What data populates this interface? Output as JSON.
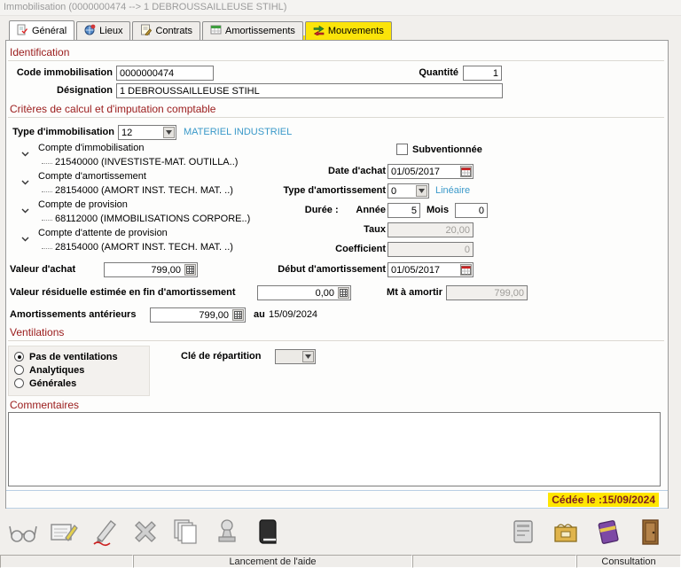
{
  "window": {
    "title": "Immobilisation (0000000474 --> 1 DEBROUSSAILLEUSE STIHL)"
  },
  "tabs": [
    {
      "label": "Général",
      "active": true
    },
    {
      "label": "Lieux",
      "active": false
    },
    {
      "label": "Contrats",
      "active": false
    },
    {
      "label": "Amortissements",
      "active": false
    },
    {
      "label": "Mouvements",
      "active": false,
      "highlighted": true
    }
  ],
  "identification": {
    "section_title": "Identification",
    "code_label": "Code immobilisation",
    "code_value": "0000000474",
    "quantite_label": "Quantité",
    "quantite_value": "1",
    "designation_label": "Désignation",
    "designation_value": "1 DEBROUSSAILLEUSE STIHL"
  },
  "criteres": {
    "section_title": "Critères de calcul et d'imputation comptable",
    "type_immobilisation_label": "Type d'immobilisation",
    "type_immobilisation_value": "12",
    "type_immobilisation_name": "MATERIEL INDUSTRIEL",
    "comptes": [
      {
        "label": "Compte d'immobilisation",
        "value": "21540000 (INVESTISTE-MAT. OUTILLA..)"
      },
      {
        "label": "Compte d'amortissement",
        "value": "28154000 (AMORT INST. TECH. MAT. ..)"
      },
      {
        "label": "Compte de provision",
        "value": "68112000 (IMMOBILISATIONS CORPORE..)"
      },
      {
        "label": "Compte d'attente de provision",
        "value": "28154000 (AMORT INST. TECH. MAT. ..)"
      }
    ],
    "subventionnee_label": "Subventionnée",
    "subventionnee_checked": false,
    "date_achat_label": "Date d'achat",
    "date_achat_value": "01/05/2017",
    "type_amortissement_label": "Type d'amortissement",
    "type_amortissement_value": "0",
    "type_amortissement_name": "Linéaire",
    "duree_label": "Durée :",
    "annee_label": "Année",
    "annee_value": "5",
    "mois_label": "Mois",
    "mois_value": "0",
    "taux_label": "Taux",
    "taux_value": "20,00",
    "coefficient_label": "Coefficient",
    "coefficient_value": "0",
    "valeur_achat_label": "Valeur d'achat",
    "valeur_achat_value": "799,00",
    "debut_amortissement_label": "Début d'amortissement",
    "debut_amortissement_value": "01/05/2017",
    "valeur_residuelle_label": "Valeur résiduelle estimée en fin d'amortissement",
    "valeur_residuelle_value": "0,00",
    "mt_a_amortir_label": "Mt à amortir",
    "mt_a_amortir_value": "799,00",
    "amortissements_anterieurs_label": "Amortissements antérieurs",
    "amortissements_anterieurs_value": "799,00",
    "au_label": "au",
    "au_date": "15/09/2024"
  },
  "ventilations": {
    "section_title": "Ventilations",
    "options": [
      "Pas de ventilations",
      "Analytiques",
      "Générales"
    ],
    "selected": "Pas de ventilations",
    "cle_repartition_label": "Clé de répartition",
    "cle_repartition_value": ""
  },
  "commentaires": {
    "section_title": "Commentaires",
    "value": ""
  },
  "footer": {
    "cedee_text": "Cédée le :15/09/2024"
  },
  "toolbar": {
    "left_icons": [
      "preview-glasses",
      "edit-book",
      "sign-pen",
      "delete-x",
      "copy-stack",
      "stamp",
      "black-book"
    ],
    "right_icons": [
      "computer",
      "card-file",
      "purple-book",
      "exit-door"
    ]
  },
  "statusbar": {
    "message": "Lancement de l'aide",
    "mode": "Consultation"
  },
  "colors": {
    "section_title": "#9a1b1b",
    "link_blue": "#3a99c9",
    "highlight_yellow": "#ffe600",
    "cedee_text": "#7d1f1f"
  }
}
